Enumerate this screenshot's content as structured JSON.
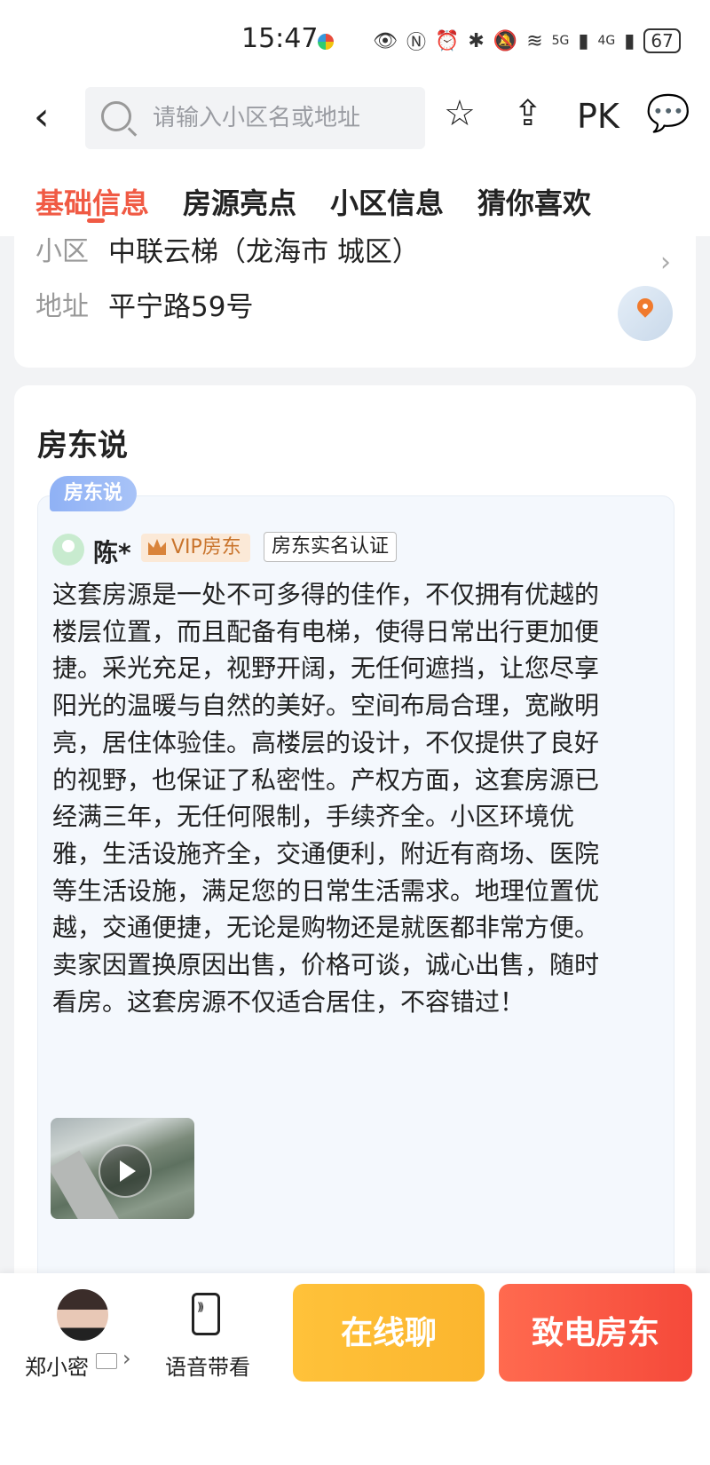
{
  "status": {
    "time": "15:47",
    "battery": "67",
    "network": [
      "5G",
      "4G"
    ]
  },
  "header": {
    "search_placeholder": "请输入小区名或地址",
    "pk_label": "PK"
  },
  "tabs": [
    {
      "label": "基础信息",
      "active": true
    },
    {
      "label": "房源亮点",
      "active": false
    },
    {
      "label": "小区信息",
      "active": false
    },
    {
      "label": "猜你喜欢",
      "active": false
    }
  ],
  "basic_info": {
    "community_label": "小区",
    "community_value": "中联云梯（龙海市 城区）",
    "address_label": "地址",
    "address_value": "平宁路59号"
  },
  "landlord_says": {
    "title": "房东说",
    "tag": "房东说",
    "owner_name": "陈*",
    "vip_label": "VIP房东",
    "verify_label": "房东实名认证",
    "text": "这套房源是一处不可多得的佳作，不仅拥有优越的楼层位置，而且配备有电梯，使得日常出行更加便捷。采光充足，视野开阔，无任何遮挡，让您尽享阳光的温暖与自然的美好。空间布局合理，宽敞明亮，居住体验佳。高楼层的设计，不仅提供了良好的视野，也保证了私密性。产权方面，这套房源已经满三年，无任何限制，手续齐全。小区环境优雅，生活设施齐全，交通便利，附近有商场、医院等生活设施，满足您的日常生活需求。地理位置优越，交通便捷，无论是购物还是就医都非常方便。卖家因置换原因出售，价格可谈，诚心出售，随时看房。这套房源不仅适合居住，不容错过！"
  },
  "bottom_bar": {
    "agent_name": "郑小密",
    "voice_label": "语音带看",
    "chat_label": "在线聊",
    "call_label": "致电房东"
  },
  "colors": {
    "accent": "#f05a44",
    "chat_button": "#fbb52e",
    "call_button": "#f5493a"
  }
}
